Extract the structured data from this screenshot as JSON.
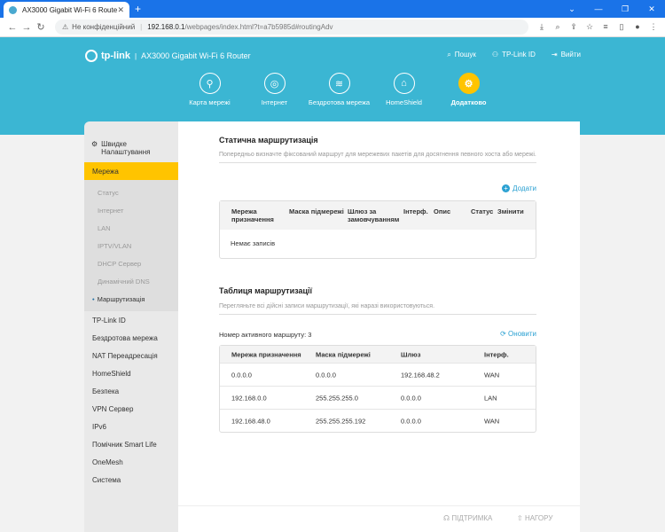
{
  "browser": {
    "tab_title": "AX3000 Gigabit Wi-Fi 6 Router",
    "tab_close": "✕",
    "new_tab": "+",
    "security_label": "Не конфіденційний",
    "url_host": "192.168.0.1",
    "url_path": "/webpages/index.html?t=a7b5985d#routingAdv"
  },
  "header": {
    "brand": "tp-link",
    "model": "AX3000 Gigabit Wi-Fi 6 Router",
    "links": [
      {
        "icon": "search-icon",
        "label": "Пошук"
      },
      {
        "icon": "user-icon",
        "label": "TP-Link ID"
      },
      {
        "icon": "logout-icon",
        "label": "Вийти"
      }
    ],
    "nav": [
      {
        "icon": "network-map-icon",
        "label": "Карта мережі"
      },
      {
        "icon": "globe-icon",
        "label": "Інтернет"
      },
      {
        "icon": "wifi-icon",
        "label": "Бездротова мережа"
      },
      {
        "icon": "homeshield-icon",
        "label": "HomeShield"
      },
      {
        "icon": "gear-icon",
        "label": "Додатково"
      }
    ],
    "accent": "#ffc400",
    "background": "#3bb6d3"
  },
  "sidebar": {
    "quick_setup": "Швидке Налаштування",
    "network": "Мережа",
    "network_sub": [
      "Статус",
      "Інтернет",
      "LAN",
      "IPTV/VLAN",
      "DHCP Сервер",
      "Динамічний DNS",
      "Маршрутизація"
    ],
    "items": [
      "TP-Link ID",
      "Бездротова мережа",
      "NAT Переадресація",
      "HomeShield",
      "Безпека",
      "VPN Сервер",
      "IPv6",
      "Помічник Smart Life",
      "OneMesh",
      "Система"
    ]
  },
  "static": {
    "title": "Статична маршрутизація",
    "desc": "Попередньо визначте фіксований маршрут для мережевих пакетів для досягнення певного хоста або мережі.",
    "add": "Додати",
    "columns": [
      "Мережа призначення",
      "Маска підмережі",
      "Шлюз за замовчуванням",
      "Інтерф.",
      "Опис",
      "Статус",
      "Змінити"
    ],
    "empty": "Немає записів"
  },
  "routing": {
    "title": "Таблиця маршрутизації",
    "desc": "Перегляньте всі дійсні записи маршрутизації, які наразі використовуються.",
    "active_label": "Номер активного маршруту: 3",
    "refresh": "Оновити",
    "columns": [
      "Мережа призначення",
      "Маска підмережі",
      "Шлюз",
      "Інтерф."
    ],
    "rows": [
      [
        "0.0.0.0",
        "0.0.0.0",
        "192.168.48.2",
        "WAN"
      ],
      [
        "192.168.0.0",
        "255.255.255.0",
        "0.0.0.0",
        "LAN"
      ],
      [
        "192.168.48.0",
        "255.255.255.192",
        "0.0.0.0",
        "WAN"
      ]
    ]
  },
  "footer": {
    "support": "ПІДТРИМКА",
    "top": "НАГОРУ"
  }
}
